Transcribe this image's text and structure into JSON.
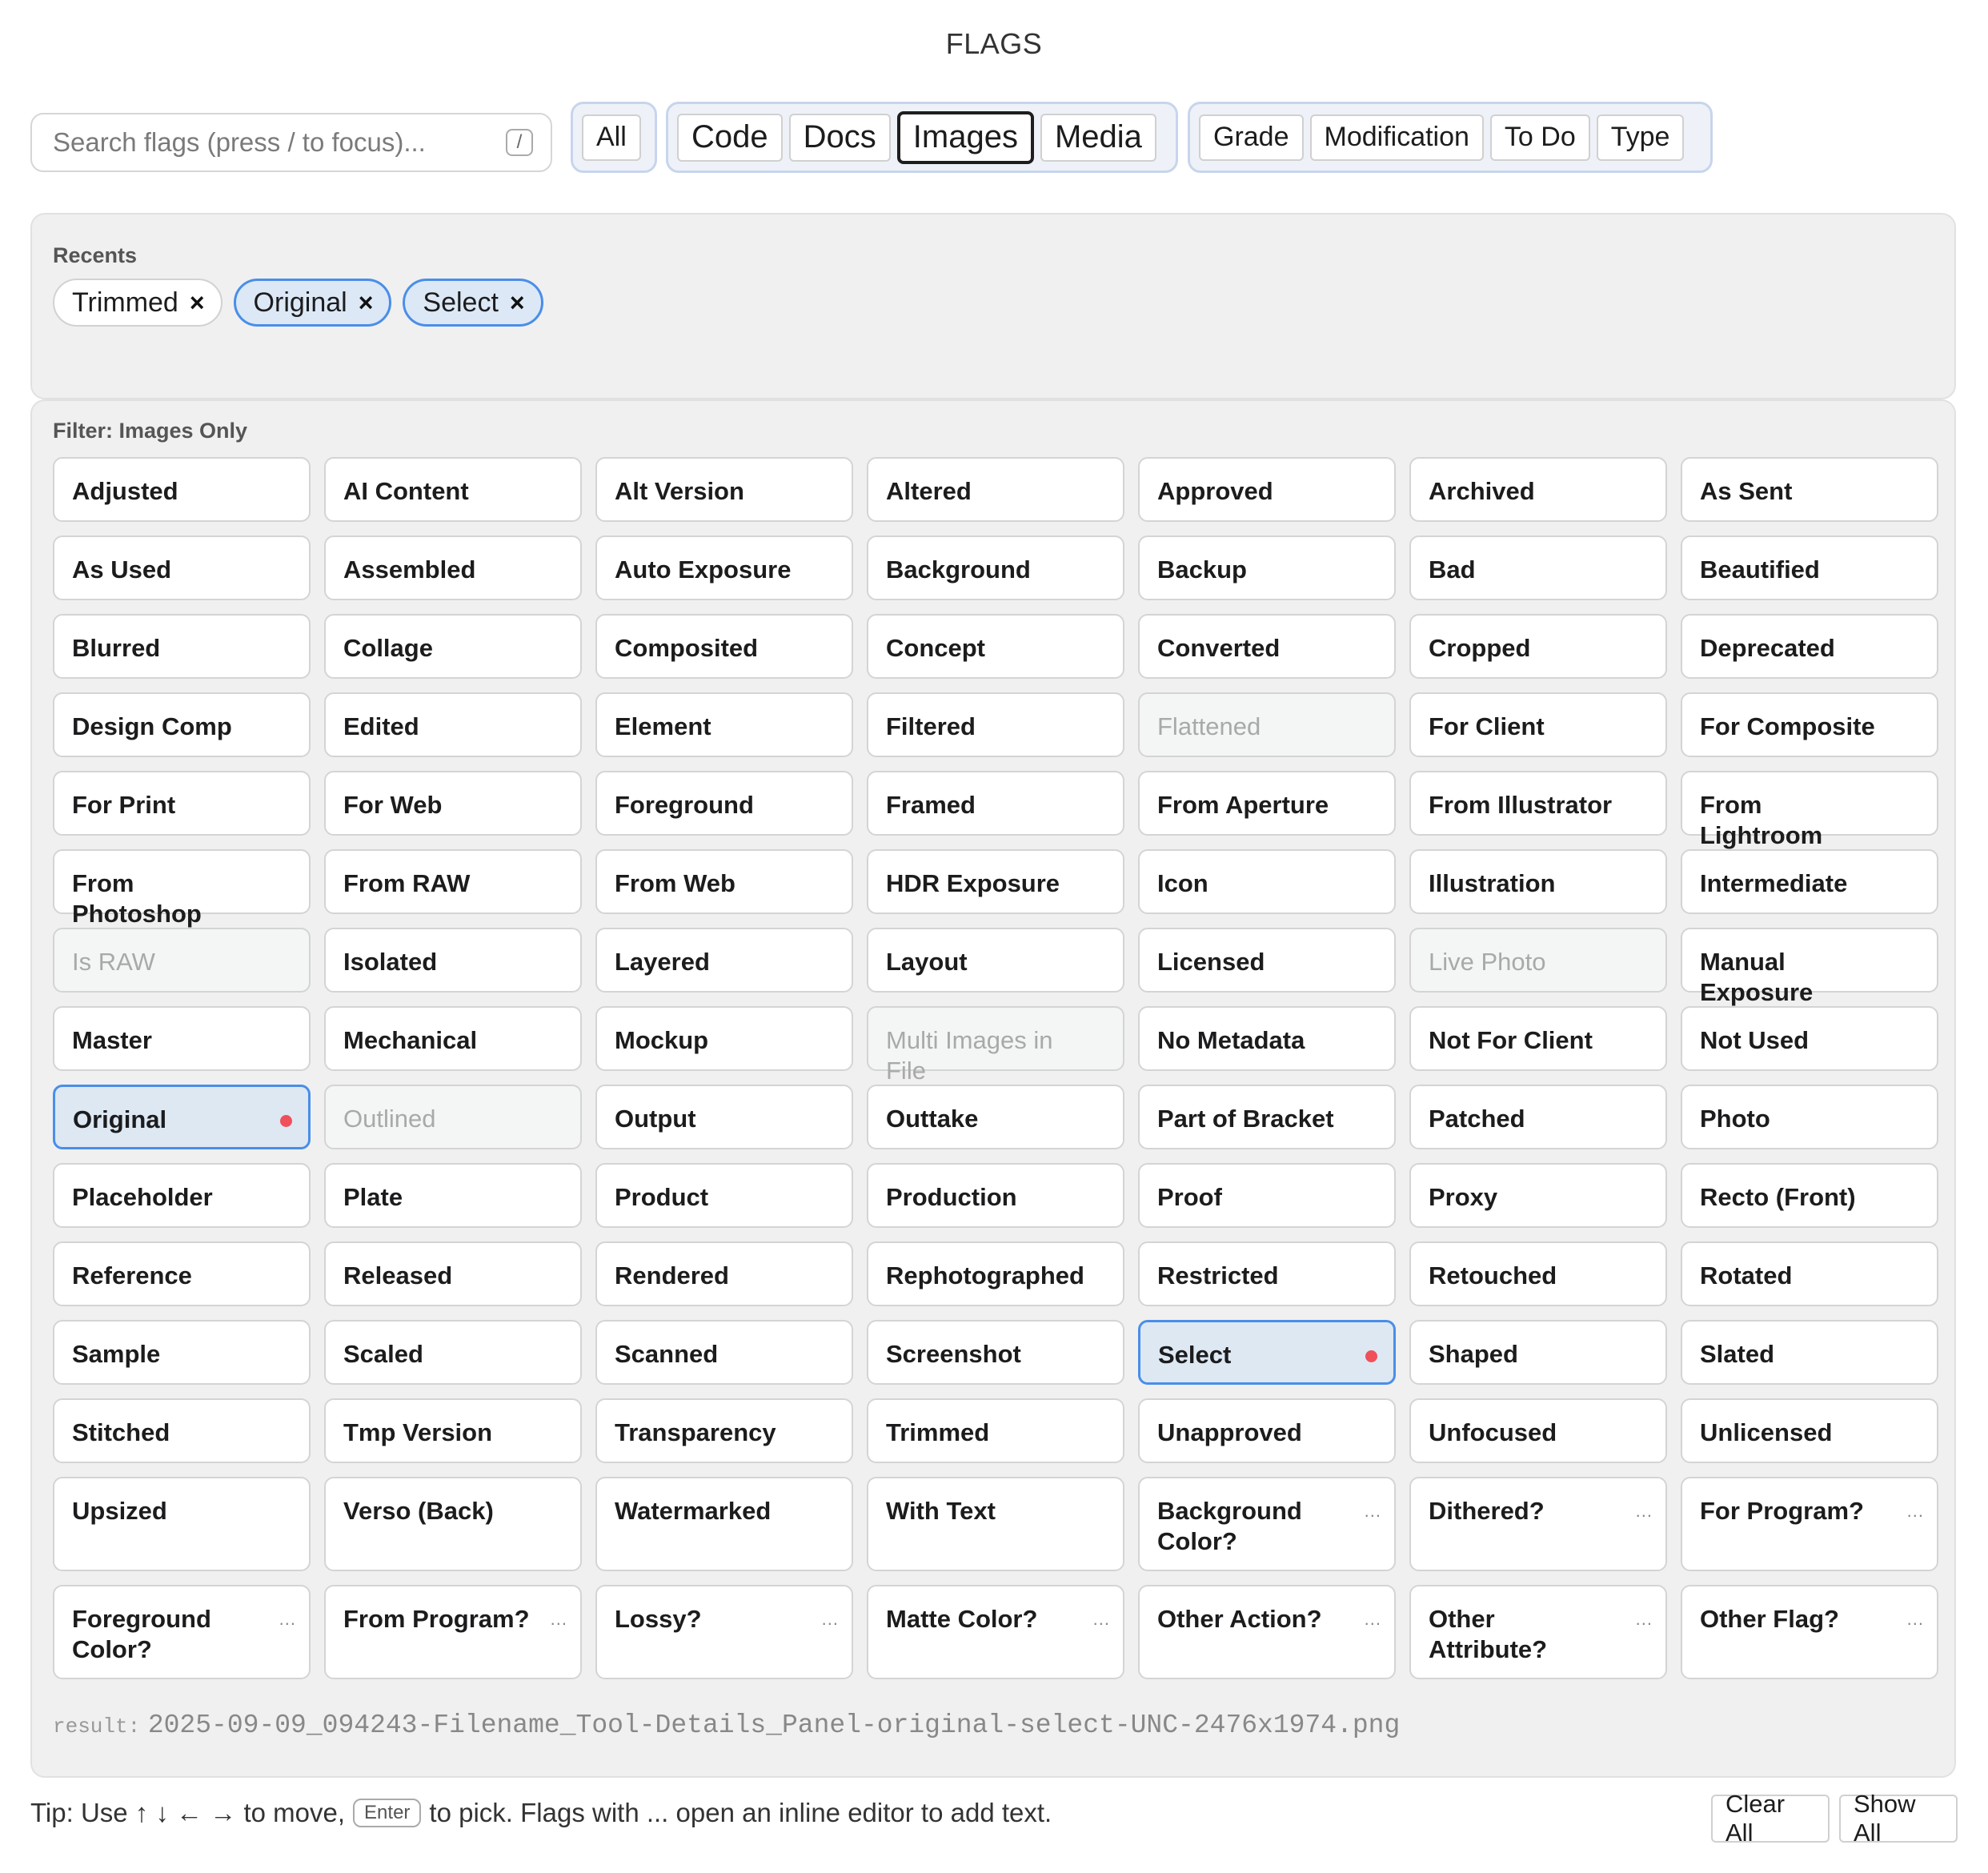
{
  "title": "FLAGS",
  "search": {
    "placeholder": "Search flags (press / to focus)...",
    "shortcut": "/"
  },
  "scope_group": {
    "all_label": "All"
  },
  "category_tabs": [
    {
      "label": "Code",
      "active": false
    },
    {
      "label": "Docs",
      "active": false
    },
    {
      "label": "Images",
      "active": true
    },
    {
      "label": "Media",
      "active": false
    }
  ],
  "tag_tabs": [
    "Grade",
    "Modification",
    "To Do",
    "Type"
  ],
  "recents": {
    "heading": "Recents",
    "items": [
      {
        "label": "Trimmed",
        "selected": false
      },
      {
        "label": "Original",
        "selected": true
      },
      {
        "label": "Select",
        "selected": true
      }
    ],
    "remove_glyph": "×"
  },
  "flags": {
    "heading": "Filter: Images Only",
    "items": [
      {
        "label": "Adjusted"
      },
      {
        "label": "AI Content"
      },
      {
        "label": "Alt Version"
      },
      {
        "label": "Altered"
      },
      {
        "label": "Approved"
      },
      {
        "label": "Archived"
      },
      {
        "label": "As Sent"
      },
      {
        "label": "As Used"
      },
      {
        "label": "Assembled"
      },
      {
        "label": "Auto Exposure"
      },
      {
        "label": "Background"
      },
      {
        "label": "Backup"
      },
      {
        "label": "Bad"
      },
      {
        "label": "Beautified"
      },
      {
        "label": "Blurred"
      },
      {
        "label": "Collage"
      },
      {
        "label": "Composited"
      },
      {
        "label": "Concept"
      },
      {
        "label": "Converted"
      },
      {
        "label": "Cropped"
      },
      {
        "label": "Deprecated"
      },
      {
        "label": "Design Comp"
      },
      {
        "label": "Edited"
      },
      {
        "label": "Element"
      },
      {
        "label": "Filtered"
      },
      {
        "label": "Flattened",
        "state": "disabled"
      },
      {
        "label": "For Client"
      },
      {
        "label": "For Composite"
      },
      {
        "label": "For Print"
      },
      {
        "label": "For Web"
      },
      {
        "label": "Foreground"
      },
      {
        "label": "Framed"
      },
      {
        "label": "From Aperture"
      },
      {
        "label": "From Illustrator"
      },
      {
        "label": "From Lightroom"
      },
      {
        "label": "From Photoshop"
      },
      {
        "label": "From RAW"
      },
      {
        "label": "From Web"
      },
      {
        "label": "HDR Exposure"
      },
      {
        "label": "Icon"
      },
      {
        "label": "Illustration"
      },
      {
        "label": "Intermediate"
      },
      {
        "label": "Is RAW",
        "state": "disabled"
      },
      {
        "label": "Isolated"
      },
      {
        "label": "Layered"
      },
      {
        "label": "Layout"
      },
      {
        "label": "Licensed"
      },
      {
        "label": "Live Photo",
        "state": "disabled"
      },
      {
        "label": "Manual Exposure"
      },
      {
        "label": "Master"
      },
      {
        "label": "Mechanical"
      },
      {
        "label": "Mockup"
      },
      {
        "label": "Multi Images in File",
        "state": "disabled"
      },
      {
        "label": "No Metadata"
      },
      {
        "label": "Not For Client"
      },
      {
        "label": "Not Used"
      },
      {
        "label": "Original",
        "state": "selected"
      },
      {
        "label": "Outlined",
        "state": "disabled"
      },
      {
        "label": "Output"
      },
      {
        "label": "Outtake"
      },
      {
        "label": "Part of Bracket"
      },
      {
        "label": "Patched"
      },
      {
        "label": "Photo"
      },
      {
        "label": "Placeholder"
      },
      {
        "label": "Plate"
      },
      {
        "label": "Product"
      },
      {
        "label": "Production"
      },
      {
        "label": "Proof"
      },
      {
        "label": "Proxy"
      },
      {
        "label": "Recto (Front)"
      },
      {
        "label": "Reference"
      },
      {
        "label": "Released"
      },
      {
        "label": "Rendered"
      },
      {
        "label": "Rephotographed"
      },
      {
        "label": "Restricted"
      },
      {
        "label": "Retouched"
      },
      {
        "label": "Rotated"
      },
      {
        "label": "Sample"
      },
      {
        "label": "Scaled"
      },
      {
        "label": "Scanned"
      },
      {
        "label": "Screenshot"
      },
      {
        "label": "Select",
        "state": "selected"
      },
      {
        "label": "Shaped"
      },
      {
        "label": "Slated"
      },
      {
        "label": "Stitched"
      },
      {
        "label": "Tmp Version"
      },
      {
        "label": "Transparency"
      },
      {
        "label": "Trimmed"
      },
      {
        "label": "Unapproved"
      },
      {
        "label": "Unfocused"
      },
      {
        "label": "Unlicensed"
      },
      {
        "label": "Upsized",
        "tall": true
      },
      {
        "label": "Verso (Back)",
        "tall": true
      },
      {
        "label": "Watermarked",
        "tall": true
      },
      {
        "label": "With Text",
        "tall": true
      },
      {
        "label": "Background Color?",
        "editor": true,
        "tall": true
      },
      {
        "label": "Dithered?",
        "editor": true,
        "tall": true
      },
      {
        "label": "For Program?",
        "editor": true,
        "tall": true
      },
      {
        "label": "Foreground Color?",
        "editor": true,
        "tall": true
      },
      {
        "label": "From Program?",
        "editor": true,
        "tall": true
      },
      {
        "label": "Lossy?",
        "editor": true,
        "tall": true
      },
      {
        "label": "Matte Color?",
        "editor": true,
        "tall": true
      },
      {
        "label": "Other Action?",
        "editor": true,
        "tall": true
      },
      {
        "label": "Other Attribute?",
        "editor": true,
        "tall": true
      },
      {
        "label": "Other Flag?",
        "editor": true,
        "tall": true
      }
    ],
    "editor_glyph": "...",
    "selected_dot_color": "#f0505a"
  },
  "result": {
    "key": "result:",
    "value": "2025-09-09_094243-Filename_Tool-Details_Panel-original-select-UNC-2476x1974.png"
  },
  "footer": {
    "tip_before": "Tip: Use ↑ ↓ ← → to move,",
    "tip_key": "Enter",
    "tip_after": "to pick. Flags with ... open an inline editor to add text.",
    "clear_all": "Clear All",
    "show_all": "Show All"
  },
  "colors": {
    "accent_border": "#4a8ee8",
    "selected_fill": "#dde8f3",
    "group_border": "#c7d5ec",
    "panel_bg": "#f0f0f0"
  }
}
